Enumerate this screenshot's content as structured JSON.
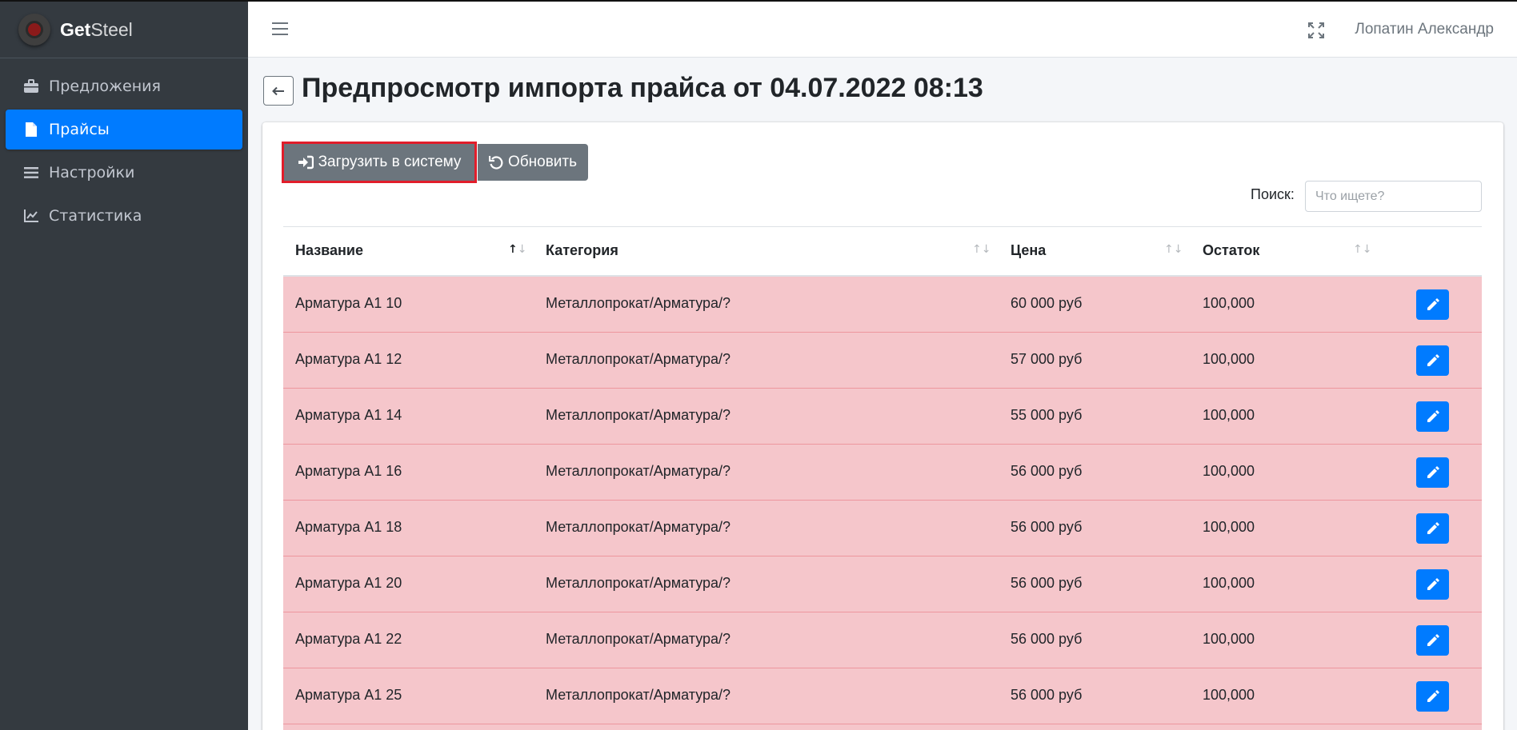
{
  "brand": {
    "bold": "Get",
    "light": "Steel"
  },
  "sidebar": {
    "items": [
      {
        "label": "Предложения",
        "icon": "briefcase-icon",
        "active": false
      },
      {
        "label": "Прайсы",
        "icon": "file-icon",
        "active": true
      },
      {
        "label": "Настройки",
        "icon": "list-icon",
        "active": false
      },
      {
        "label": "Статистика",
        "icon": "chart-line-icon",
        "active": false
      }
    ]
  },
  "topbar": {
    "user_name": "Лопатин Александр"
  },
  "page": {
    "title": "Предпросмотр импорта прайса от 04.07.2022 08:13"
  },
  "toolbar": {
    "upload_label": "Загрузить в систему",
    "refresh_label": "Обновить"
  },
  "search": {
    "label": "Поиск:",
    "placeholder": "Что ищете?"
  },
  "table": {
    "headers": [
      "Название",
      "Категория",
      "Цена",
      "Остаток"
    ],
    "rows": [
      [
        "Арматура А1 10",
        "Металлопрокат/Арматура/?",
        "60 000 руб",
        "100,000"
      ],
      [
        "Арматура А1 12",
        "Металлопрокат/Арматура/?",
        "57 000 руб",
        "100,000"
      ],
      [
        "Арматура А1 14",
        "Металлопрокат/Арматура/?",
        "55 000 руб",
        "100,000"
      ],
      [
        "Арматура А1 16",
        "Металлопрокат/Арматура/?",
        "56 000 руб",
        "100,000"
      ],
      [
        "Арматура А1 18",
        "Металлопрокат/Арматура/?",
        "56 000 руб",
        "100,000"
      ],
      [
        "Арматура А1 20",
        "Металлопрокат/Арматура/?",
        "56 000 руб",
        "100,000"
      ],
      [
        "Арматура А1 22",
        "Металлопрокат/Арматура/?",
        "56 000 руб",
        "100,000"
      ],
      [
        "Арматура А1 25",
        "Металлопрокат/Арматура/?",
        "56 000 руб",
        "100,000"
      ]
    ]
  },
  "colors": {
    "accent": "#007bff",
    "sidebar_bg": "#343a40",
    "row_danger": "#f5c6cb",
    "button_secondary": "#6c757d",
    "highlight_border": "#e11d2a"
  }
}
